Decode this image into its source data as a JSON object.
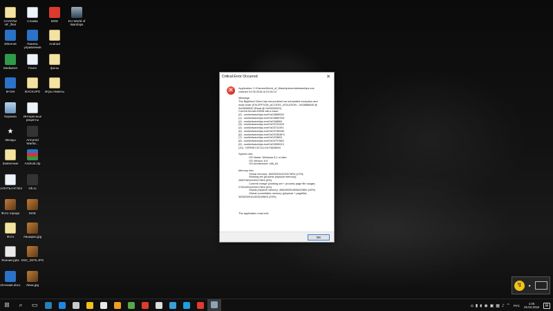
{
  "desktop": {
    "icons": [
      {
        "label": "САЛАТЫ НГ_files",
        "kind": "folder"
      },
      {
        "label": "Слаква",
        "kind": "doc"
      },
      {
        "label": "MOE",
        "kind": "red"
      },
      {
        "label": "EU World of Warships",
        "kind": "ship"
      },
      {
        "label": "Ethernet",
        "kind": "blue"
      },
      {
        "label": "Панель управления",
        "kind": "blue"
      },
      {
        "label": "Android",
        "kind": "folder"
      },
      {
        "label": "MediaGet",
        "kind": "green"
      },
      {
        "label": "Feers",
        "kind": "doc"
      },
      {
        "label": "фоны",
        "kind": "folder"
      },
      {
        "label": "M-Get",
        "kind": "blue"
      },
      {
        "label": "BACKUPS",
        "kind": "folder"
      },
      {
        "label": "Игры Никиты",
        "kind": "folder"
      },
      {
        "label": "Корзина",
        "kind": "trash"
      },
      {
        "label": "Интересные рецепты",
        "kind": "doc"
      },
      {
        "label": "Звезды",
        "kind": "star"
      },
      {
        "label": "Armored Warfar...",
        "kind": "dark"
      },
      {
        "label": "Заявление",
        "kind": "folder"
      },
      {
        "label": "Android.zip",
        "kind": "flag"
      },
      {
        "label": "САЛАТЫ НГ.htm",
        "kind": "doc"
      },
      {
        "label": "Ok.ru",
        "kind": "dark"
      },
      {
        "label": "Фото города",
        "kind": "img"
      },
      {
        "label": "MAE",
        "kind": "img"
      },
      {
        "label": "Фото",
        "kind": "folder"
      },
      {
        "label": "Авшарка.jpg",
        "kind": "img"
      },
      {
        "label": "Ясения.pptx",
        "kind": "black"
      },
      {
        "label": "DSC_0075.JPG",
        "kind": "img"
      },
      {
        "label": "Исчения.docx",
        "kind": "blue"
      },
      {
        "label": "Лена.jpg",
        "kind": "img"
      }
    ]
  },
  "dialog": {
    "title": "Critical Error Occurred",
    "close_glyph": "✕",
    "icon_glyph": "✕",
    "body": "Application: C:/Games/World_of_Warships/worldofwarships.exe\ncrashed 01.05.2018 at 01:04:13\n\nMessage:\nThe BigWorld Client has encountered an unhandled exception and\nmust close (EXCEPTION_ACCESS_VIOLATION : 0x03888805 @\n0x03889530 (Read @ 0x00000000)\nCurrent thread #3536 call-a trace:\n(0) : worldofwarships.exe!0x03889530\n(1) : worldofwarships.exe!0x0388976D\n(2) : worldofwarships.exe!0x0348961\n(3) : worldofwarships.exe!0x03702428\n(4) : worldofwarships.exe!0x03711091\n(5) : worldofwarships.exe!0x0379B184\n(6) : worldofwarships.exe!0x0378D6F4\n(7) : worldofwarships.exe!0x0378891\n(8) : worldofwarships.exe!0x03797882\n(9) : worldofwarships.exe!0x03595913\n(10) : KERNEL32.DLL!0x74628654\n\nSystem info:\n              OS Name: Windows 8.1 or later\n              OS Version: 6.6\n              OS Architecture: x86_64\n\nMemory info:\n              Virtual memory: 480252Kb/4194176Kb (12%)\n              Working set (process physical memory):\n265076Kb/4194176Kb (6%)\n              Commit charge (working set + process page file usage):\n278232Kb/4194176Kb (6%)\n              Global physical memory: 4082892Kb/8306228Kb (49%)\n              Global commitable memory (physical + pagefile):\n3008292Kb/14532436Kb (20%)\n\n\n\n\nThe application must exit.",
    "ok_label": "OK"
  },
  "tray_popup": {
    "icon_glyph": "↯",
    "arrow_glyph": "▸"
  },
  "taskbar": {
    "start_glyph": "⊞",
    "search_glyph": "⌕",
    "taskview_glyph": "▭",
    "apps": [
      {
        "name": "calculator",
        "color": "#2a7fb8"
      },
      {
        "name": "edge",
        "color": "#1e88e5"
      },
      {
        "name": "mail",
        "color": "#c9c9c9"
      },
      {
        "name": "explorer",
        "color": "#f2c21a"
      },
      {
        "name": "store",
        "color": "#e8e8e8"
      },
      {
        "name": "photos",
        "color": "#f0a020"
      },
      {
        "name": "pictures",
        "color": "#59a84b"
      },
      {
        "name": "yandex-1",
        "color": "#e23b2e"
      },
      {
        "name": "calendar",
        "color": "#dddddd"
      },
      {
        "name": "app-blue",
        "color": "#3aa0d8"
      },
      {
        "name": "skype",
        "color": "#1e9ee0"
      },
      {
        "name": "yandex-2",
        "color": "#e23b2e"
      },
      {
        "name": "warships",
        "color": "#8aa4b8"
      }
    ],
    "tray_icons": [
      "network-icon",
      "battery-icon",
      "volume-icon",
      "wifi-icon",
      "monitor-icon",
      "keyboard-icon",
      "speaker-icon",
      "chevron-icon"
    ],
    "tray_glyphs": [
      "⌂",
      "▮",
      "◖",
      "◉",
      "▣",
      "▦",
      "♪",
      "^"
    ],
    "language": "РУС",
    "time": "1:05",
    "date": "25.03.2018",
    "notifications_glyph": "▤"
  }
}
